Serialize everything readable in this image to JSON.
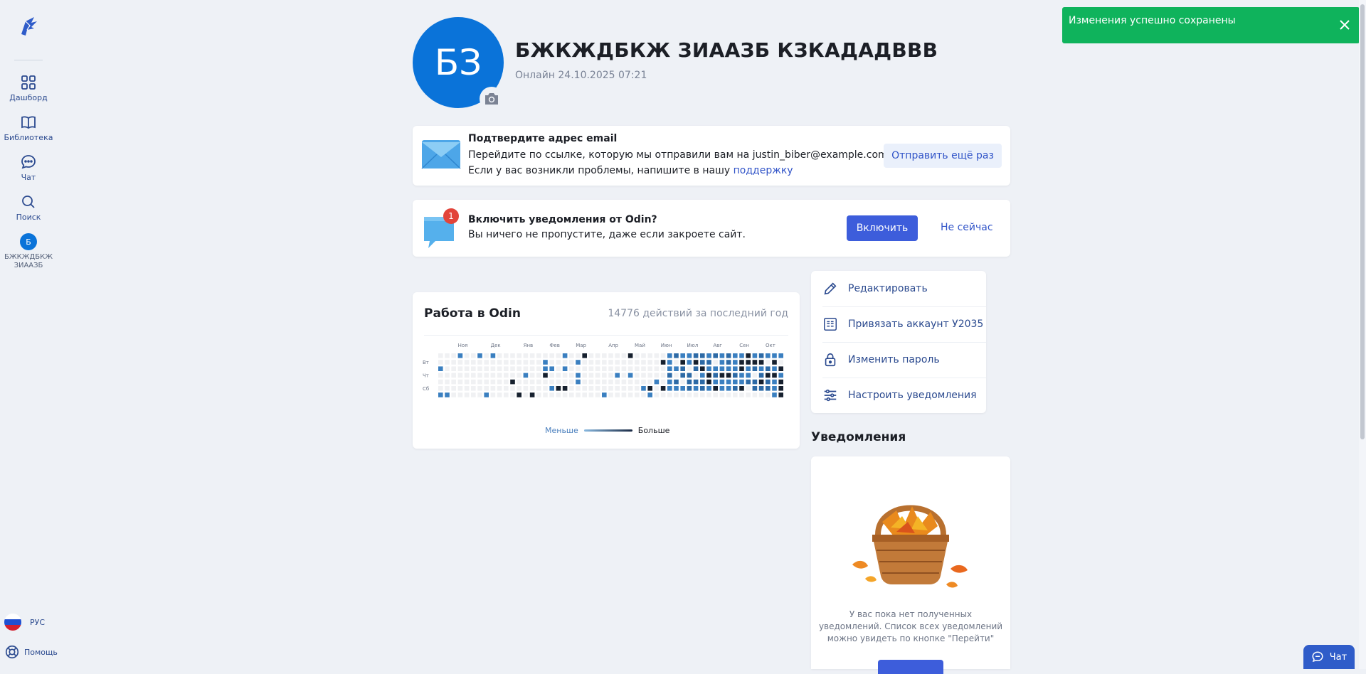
{
  "sidebar": {
    "logo_icon": "odin-logo-icon",
    "items": [
      {
        "label": "Дашборд",
        "icon": "dashboard-grid-icon"
      },
      {
        "label": "Библиотека",
        "icon": "book-icon"
      },
      {
        "label": "Чат",
        "icon": "chat-bubble-icon"
      },
      {
        "label": "Поиск",
        "icon": "search-icon"
      }
    ],
    "user": {
      "initial": "Б",
      "name_line1": "БЖКЖДБКЖ",
      "name_line2": "ЗИААЗБ"
    },
    "language": "РУС",
    "help": "Помощь"
  },
  "profile": {
    "initials": "БЗ",
    "name": "БЖКЖДБКЖ ЗИААЗБ КЗКАДАДВВВ",
    "status": "Онлайн 24.10.2025 07:21"
  },
  "email_card": {
    "title": "Подтвердите адрес email",
    "line1": "Перейдите по ссылке, которую мы отправили вам на justin_biber@example.com.",
    "line2_prefix": "Если у вас возникли проблемы, напишите в нашу ",
    "line2_link": "поддержку",
    "resend_button": "Отправить ещё раз"
  },
  "notify_card": {
    "badge": "1",
    "title": "Включить уведомления от Odin?",
    "text": "Вы ничего не пропустите, даже если закроете сайт.",
    "enable_button": "Включить",
    "later_button": "Не сейчас"
  },
  "activity": {
    "title": "Работа в Odin",
    "count_text": "14776 действий за последний год",
    "months": [
      "Ноя",
      "Дек",
      "Янв",
      "Фев",
      "Мар",
      "Апр",
      "Май",
      "Июн",
      "Июл",
      "Авг",
      "Сен",
      "Окт"
    ],
    "day_labels": [
      "Вт",
      "Чт",
      "Сб"
    ],
    "legend_less": "Меньше",
    "legend_more": "Больше",
    "colors": {
      "empty": "#f0f1f3",
      "level1": "#3a7fc0",
      "level2": "#2d6aa6",
      "level3": "#16202e"
    }
  },
  "actions": {
    "items": [
      {
        "label": "Редактировать",
        "icon": "pencil-icon"
      },
      {
        "label": "Привязать аккаунт У2035",
        "icon": "u2035-icon"
      },
      {
        "label": "Изменить пароль",
        "icon": "lock-icon"
      },
      {
        "label": "Настроить уведомления",
        "icon": "sliders-icon"
      }
    ]
  },
  "notifications": {
    "heading": "Уведомления",
    "empty_text": "У вас пока нет полученных уведомлений. Список всех уведомлений можно увидеть по кнопке \"Перейти\"",
    "image_icon": "autumn-basket-illustration"
  },
  "toast": {
    "message": "Изменения успешно сохранены",
    "color": "#0fb35c"
  },
  "chat_button": {
    "label": "Чат"
  }
}
